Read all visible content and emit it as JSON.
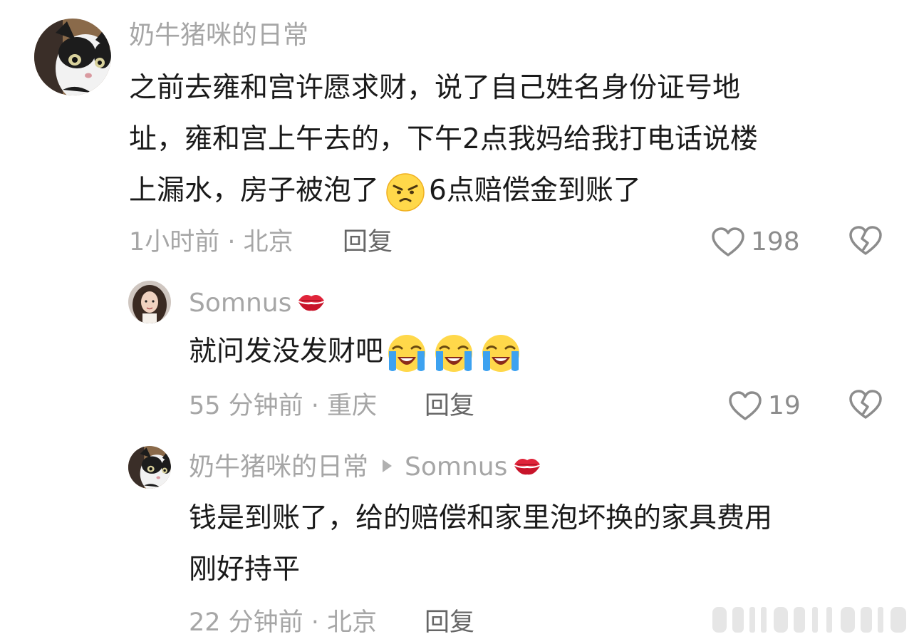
{
  "comments": [
    {
      "username": "奶牛猪咪的日常",
      "text_lines": [
        "之前去雍和宫许愿求财，说了自己姓名身份证号地",
        "址，雍和宫上午去的，下午2点我妈给我打电话说楼",
        "上漏水，房子被泡了"
      ],
      "text_after_emoji": "6点赔偿金到账了",
      "emoji": "frowning-face-emoji",
      "time_location": "1小时前 · 北京",
      "reply_label": "回复",
      "like_count": "198",
      "avatar": "black-white-cat-avatar"
    },
    {
      "username": "Somnus",
      "username_emoji": "kiss-mark-emoji",
      "text": "就问发没发财吧",
      "emojis": [
        "loudly-crying-face-emoji",
        "loudly-crying-face-emoji",
        "loudly-crying-face-emoji"
      ],
      "time_location": "55 分钟前 · 重庆",
      "reply_label": "回复",
      "like_count": "19",
      "avatar": "woman-portrait-avatar"
    },
    {
      "username": "奶牛猪咪的日常",
      "reply_to": "Somnus",
      "reply_to_emoji": "kiss-mark-emoji",
      "text_lines": [
        "钱是到账了，给的赔偿和家里泡坏换的家具费用",
        "刚好持平"
      ],
      "time_location": "22 分钟前 · 北京",
      "reply_label": "回复",
      "avatar": "black-white-cat-avatar"
    }
  ],
  "icons": {
    "like": "heart-outline-icon",
    "dislike": "broken-heart-icon"
  },
  "colors": {
    "username": "#a6a6a6",
    "body": "#1a1a1a",
    "meta": "#a6a6a6",
    "reply": "#666666",
    "icon": "#8c8c8c"
  }
}
